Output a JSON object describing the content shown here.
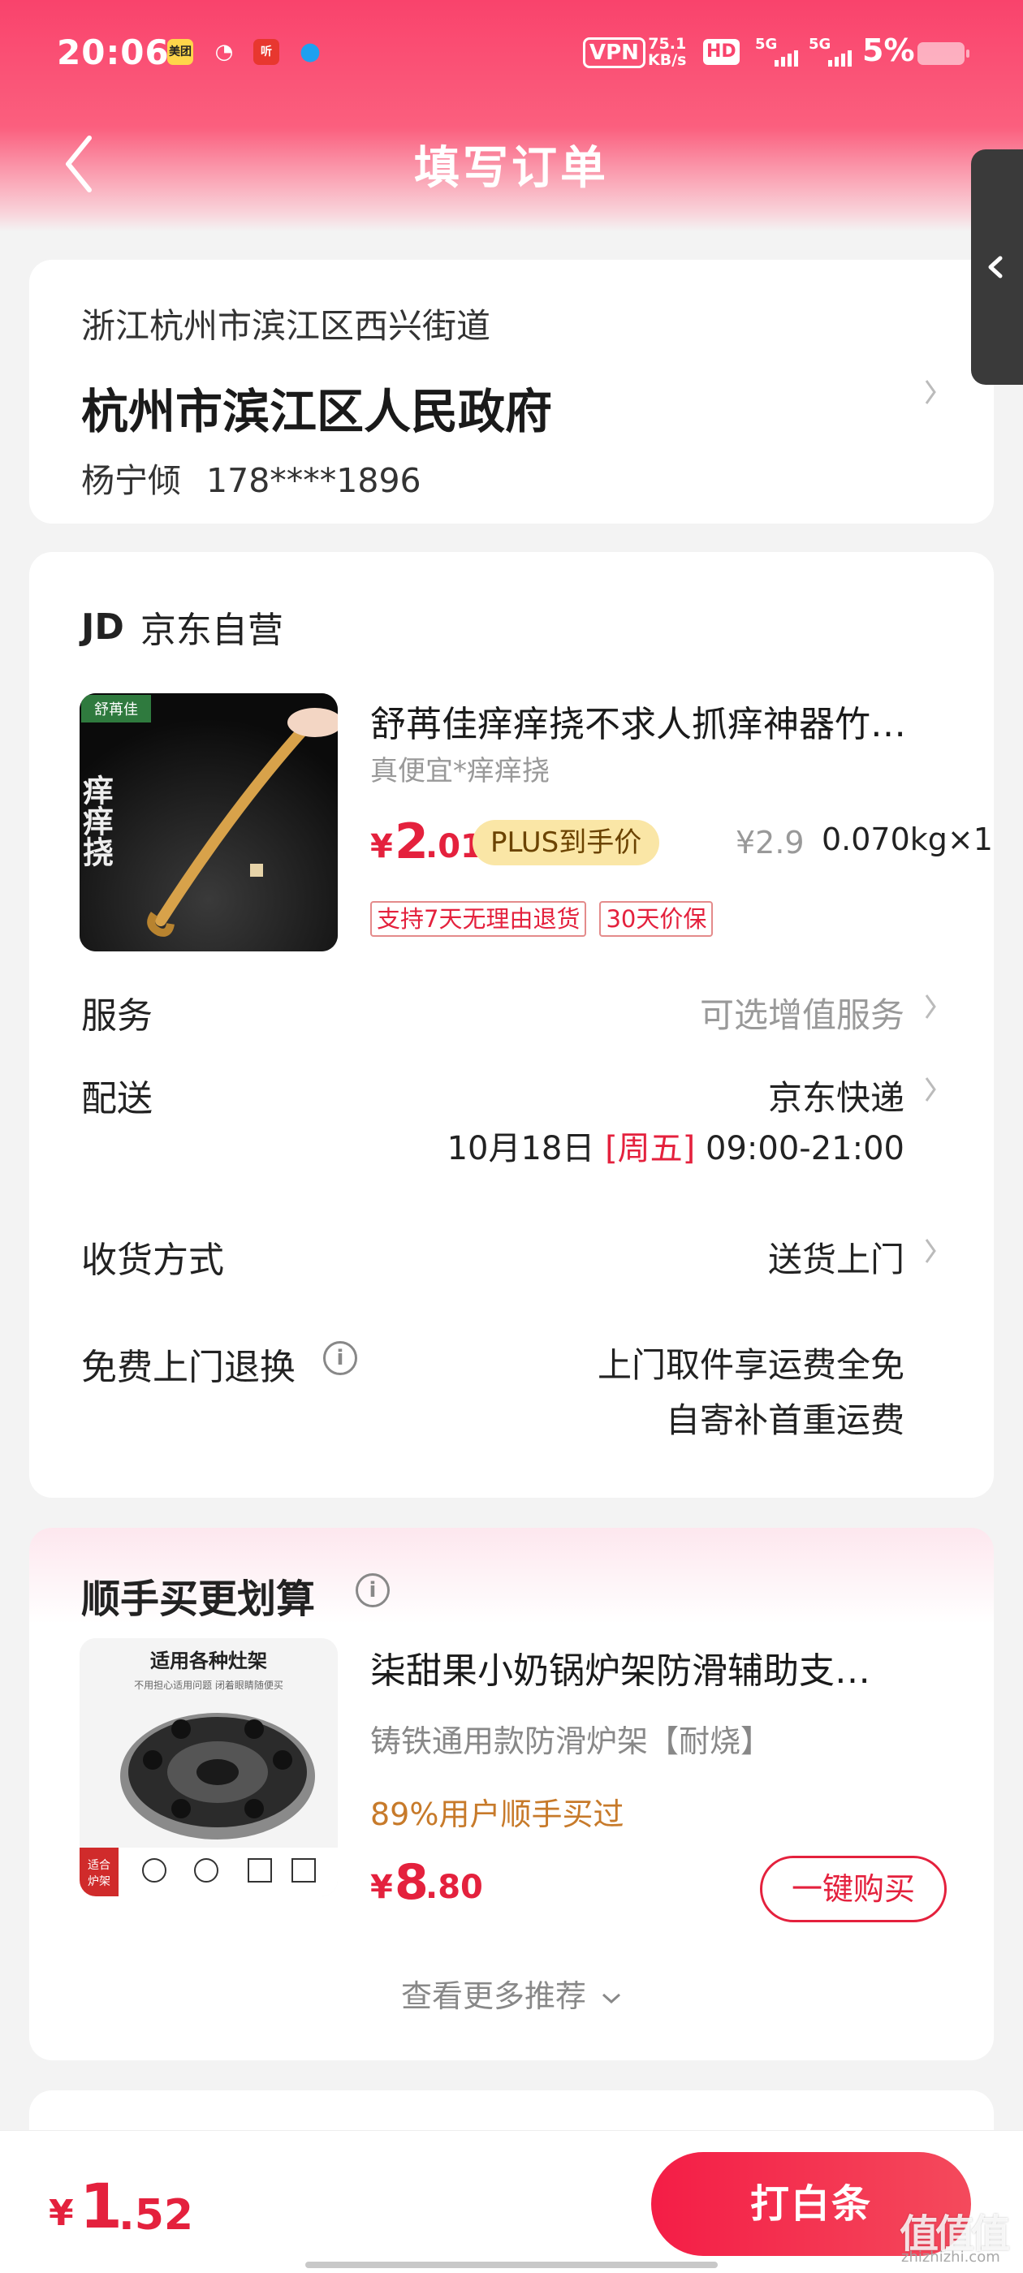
{
  "status_bar": {
    "time": "20:06",
    "apps": [
      "美团",
      "微信",
      "听",
      "QQ"
    ],
    "vpn": "VPN",
    "speed_top": "75.1",
    "speed_bottom": "KB/s",
    "hd": "HD",
    "signal_1": "5G",
    "signal_2": "5G",
    "battery_pct": "5%"
  },
  "nav": {
    "title": "填写订单",
    "back_icon": "chevron-left-icon"
  },
  "address": {
    "region": "浙江杭州市滨江区西兴街道",
    "detail": "杭州市滨江区人民政府",
    "contact_name": "杨宁倾",
    "contact_phone": "178****1896"
  },
  "order": {
    "store_logo": "JD",
    "store_name": "京东自营",
    "product": {
      "title": "舒苒佳痒痒挠不求人抓痒神器竹…",
      "subtitle": "真便宜*痒痒挠",
      "price_yen": "¥",
      "price_int": "2",
      "price_dec": ".01",
      "plus_label": "PLUS到手价",
      "orig_price": "¥2.9",
      "weight_qty": "0.070kg×1",
      "tags": [
        "支持7天无理由退货",
        "30天价保"
      ],
      "img_brand": "舒苒佳",
      "img_text": "痒痒挠"
    },
    "service_label": "服务",
    "service_value": "可选增值服务",
    "delivery_label": "配送",
    "delivery_value": "京东快递",
    "delivery_date": "10月18日",
    "delivery_weekday": "[周五]",
    "delivery_time": "09:00-21:00",
    "receive_label": "收货方式",
    "receive_value": "送货上门",
    "return_label": "免费上门退换",
    "return_value_1": "上门取件享运费全免",
    "return_value_2": "自寄补首重运费"
  },
  "recommend": {
    "title": "顺手买更划算",
    "product_name": "柒甜果小奶锅炉架防滑辅助支…",
    "product_sub": "铸铁通用款防滑炉架【耐烧】",
    "buy_pct": "89%用户顺手买过",
    "price_yen": "¥",
    "price_int": "8",
    "price_dec": ".80",
    "buy_button": "一键购买",
    "more": "查看更多推荐",
    "img_caption": "适用各种灶架",
    "img_sub": "不用担心适用问题 闭着眼睛随便买",
    "img_badge_1": "适合",
    "img_badge_2": "炉架"
  },
  "bottom": {
    "total_yen": "¥",
    "total_int": "1",
    "total_dec": ".52",
    "pay_button": "打白条"
  },
  "watermark": {
    "main": "值值值",
    "sub": "zhizhizhi.com"
  },
  "colors": {
    "brand_red": "#e4213d",
    "header_pink": "#f9436c",
    "plus_gold": "#fae6a6"
  }
}
